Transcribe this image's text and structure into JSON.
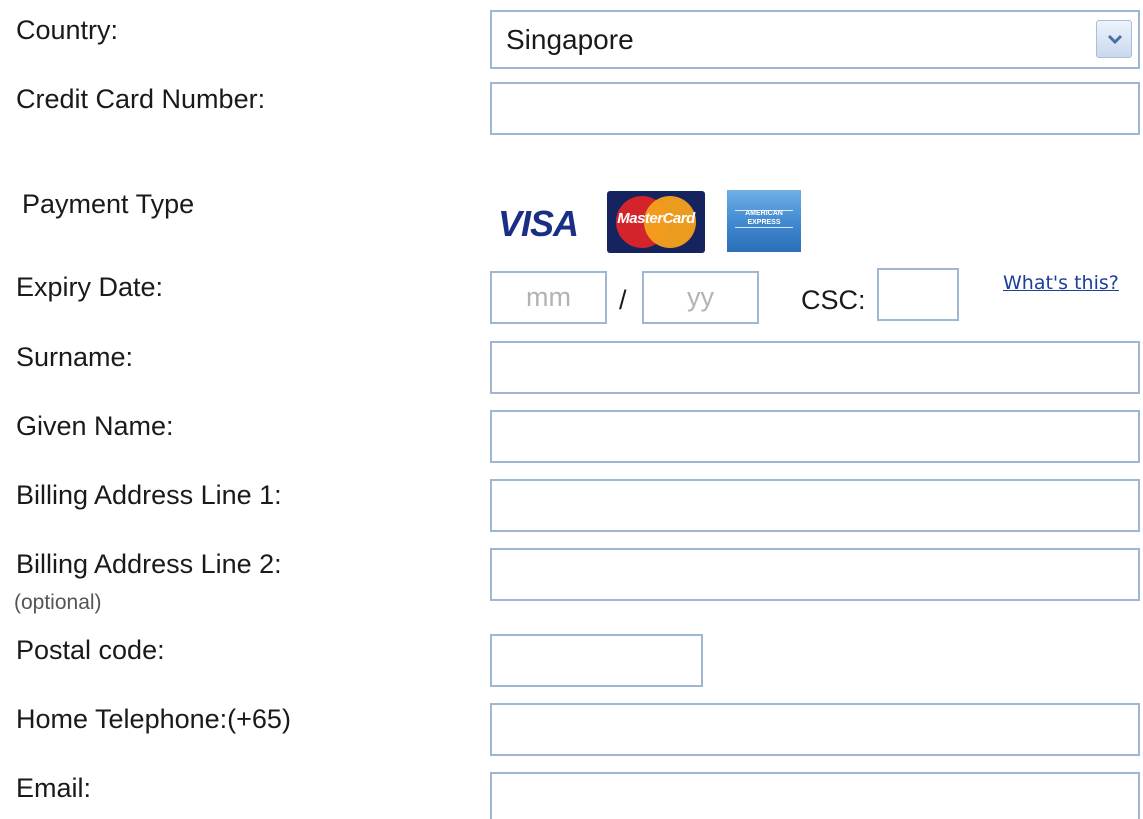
{
  "form": {
    "country": {
      "label": "Country:",
      "selected": "Singapore"
    },
    "card_number": {
      "label": "Credit Card Number:",
      "value": ""
    },
    "payment_type": {
      "label": "Payment Type",
      "cards": [
        {
          "name": "visa",
          "text": "VISA"
        },
        {
          "name": "mastercard",
          "text": "MasterCard"
        },
        {
          "name": "american-express",
          "text": "AMERICAN EXPRESS"
        }
      ]
    },
    "expiry": {
      "label": "Expiry Date:",
      "month_placeholder": "mm",
      "separator": "/",
      "year_placeholder": "yy",
      "csc_label": "CSC:",
      "help_link": "What's this?"
    },
    "surname": {
      "label": "Surname:",
      "value": ""
    },
    "given_name": {
      "label": "Given Name:",
      "value": ""
    },
    "billing_line1": {
      "label": "Billing Address Line 1:",
      "value": ""
    },
    "billing_line2": {
      "label": "Billing Address Line 2:",
      "note": "(optional)",
      "value": ""
    },
    "postal_code": {
      "label": "Postal code:",
      "value": ""
    },
    "home_telephone": {
      "label": "Home Telephone:(+65)",
      "value": ""
    },
    "email": {
      "label": "Email:",
      "value": ""
    }
  },
  "colors": {
    "field_border": "#9fb7d3",
    "link": "#1a3f9a",
    "placeholder": "#b3b3b3",
    "visa_blue": "#1a2e86",
    "mastercard_red": "#d4242b",
    "mastercard_orange": "#f5a21c",
    "amex_blue": "#3f87cf"
  },
  "icons": {
    "select_arrow": "chevron-down-icon"
  }
}
